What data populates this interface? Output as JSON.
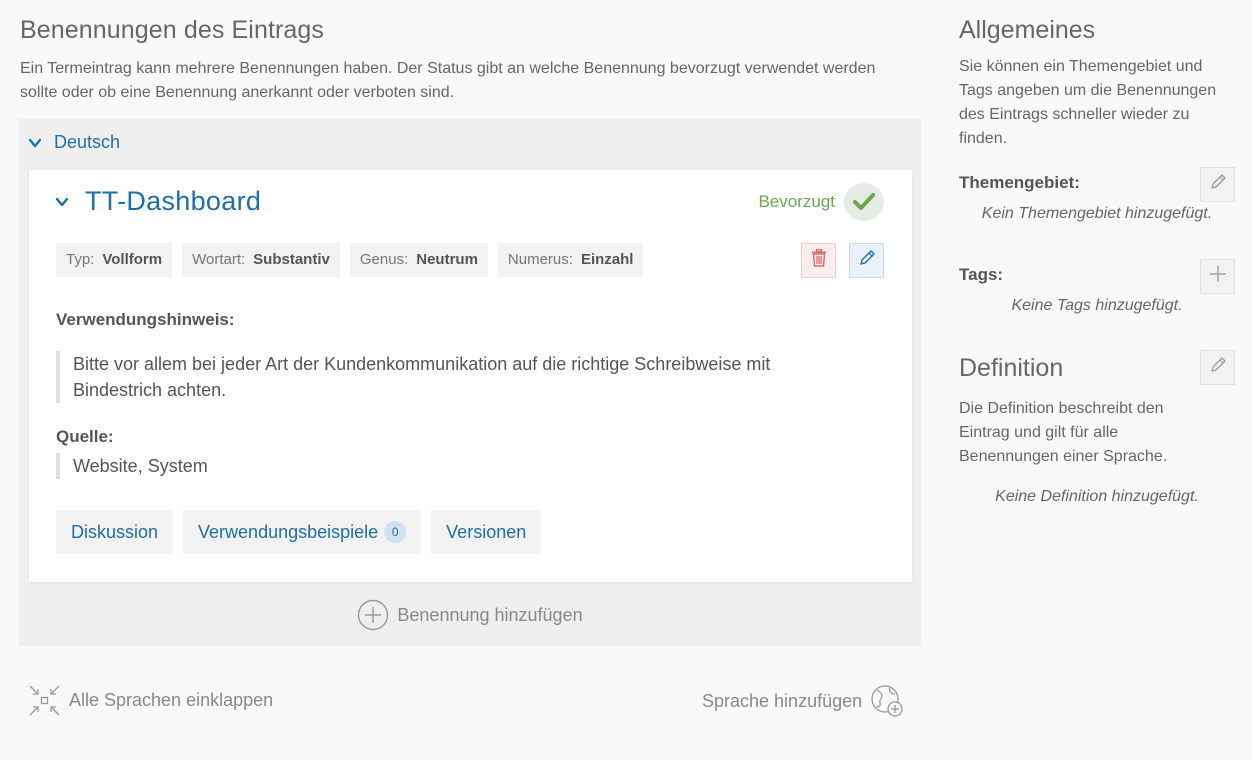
{
  "main": {
    "title": "Benennungen des Eintrags",
    "intro": "Ein Termeintrag kann mehrere Benennungen haben. Der Status gibt an welche Benennung bevorzugt verwendet werden sollte oder ob eine Benennung anerkannt oder verboten sind.",
    "language": {
      "name": "Deutsch",
      "term": {
        "title": "TT-Dashboard",
        "status_label": "Bevorzugt",
        "properties": [
          {
            "key": "Typ:",
            "value": "Vollform"
          },
          {
            "key": "Wortart:",
            "value": "Substantiv"
          },
          {
            "key": "Genus:",
            "value": "Neutrum"
          },
          {
            "key": "Numerus:",
            "value": "Einzahl"
          }
        ],
        "usage_label": "Verwendungshinweis:",
        "usage_text": "Bitte vor allem bei jeder Art der Kundenkommunikation auf die richtige Schreibweise mit Bindestrich achten.",
        "source_label": "Quelle:",
        "source_text": "Website, System",
        "tabs": {
          "discussion": "Diskussion",
          "examples": "Verwendungsbeispiele",
          "examples_count": "0",
          "versions": "Versionen"
        }
      },
      "add_term_label": "Benennung hinzufügen"
    },
    "collapse_all_label": "Alle Sprachen einklappen",
    "add_language_label": "Sprache hinzufügen"
  },
  "sidebar": {
    "general_title": "Allgemeines",
    "general_text": "Sie können ein Themengebiet und Tags angeben um die Benennungen des Eintrags schneller wieder zu finden.",
    "subject_label": "Themengebiet:",
    "subject_empty": "Kein Themengebiet hinzugefügt.",
    "tags_label": "Tags:",
    "tags_empty": "Keine Tags hinzugefügt.",
    "definition_title": "Definition",
    "definition_text": "Die Definition beschreibt den Eintrag und gilt für alle Benennungen einer Sprache.",
    "definition_empty": "Keine Definition hinzugefügt."
  },
  "colors": {
    "accent": "#1a6fb0",
    "status_green": "#6aa84f",
    "danger": "#e06666"
  },
  "icons": {
    "chevron": "chevron-down-icon",
    "status": "check-icon",
    "delete": "trash-icon",
    "edit": "pencil-icon",
    "add": "plus-icon",
    "collapse": "collapse-arrows-icon",
    "add_language": "globe-plus-icon"
  }
}
